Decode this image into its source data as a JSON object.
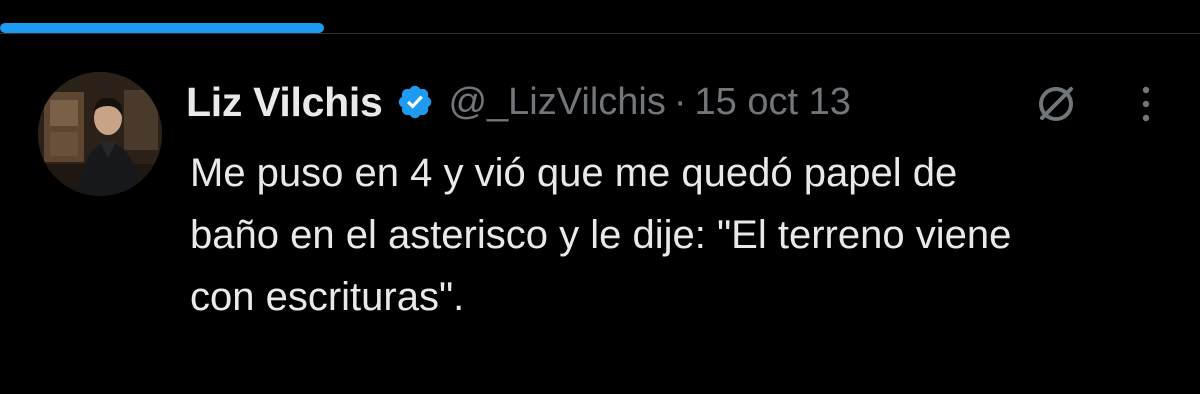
{
  "progress": {
    "fraction": 0.27,
    "color": "#1d9bf0"
  },
  "tweet": {
    "author": {
      "display_name": "Liz Vilchis",
      "handle": "@_LizVilchis",
      "verified": true,
      "avatar_icon": "profile-photo"
    },
    "separator": "·",
    "timestamp": "15 oct 13",
    "text": "Me puso en 4 y vió que me quedó papel de\nbaño en el asterisco y le dije: \"El terreno viene\ncon escrituras\".",
    "actions": {
      "grok_icon": "grok-icon",
      "more_icon": "more-vertical-icon"
    }
  },
  "colors": {
    "background": "#000000",
    "text_primary": "#e7e9ea",
    "text_secondary": "#71767b",
    "verified_badge": "#1d9bf0"
  }
}
